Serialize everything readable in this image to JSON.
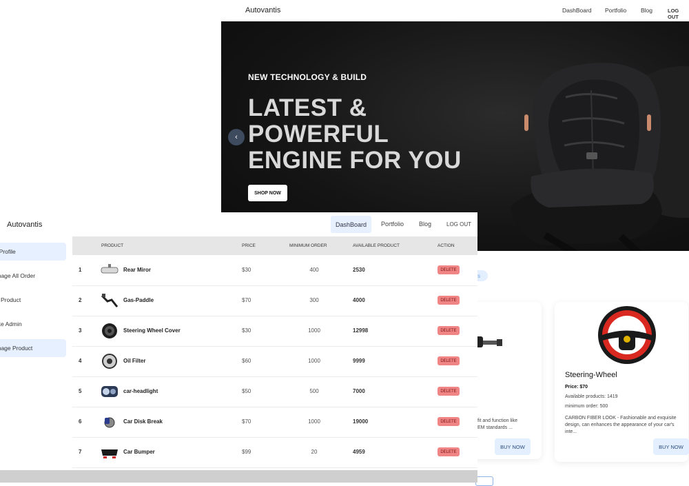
{
  "storefront": {
    "nav": {
      "brand": "Autovantis",
      "links": [
        "DashBoard",
        "Portfolio",
        "Blog",
        "LOG OUT"
      ]
    },
    "hero": {
      "kicker": "NEW TECHNOLOGY & BUILD",
      "headline": [
        "LATEST &",
        "POWERFUL",
        "ENGINE FOR YOU"
      ],
      "cta": "SHOP NOW",
      "prev_icon": "‹"
    },
    "section_badge": "ts",
    "cards": [
      {
        "title": "",
        "desc": "fit and function like\nEM standards ...",
        "buy": "BUY NOW"
      },
      {
        "title": "Steering-Wheel",
        "price": "Price: $70",
        "available": "Available products: 1419",
        "min_order": "minimum order: 500",
        "desc": "CARBON FIBER LOOK - Fashionable and exquisite design, can enhances the appearance of your car's inte...",
        "buy": "BUY NOW"
      }
    ]
  },
  "admin": {
    "nav": {
      "brand": "Autovantis",
      "dashboard": "DashBoard",
      "portfolio": "Portfolio",
      "blog": "Blog",
      "logout": "LOG OUT"
    },
    "sidebar": [
      {
        "label": "y Profile",
        "active": true
      },
      {
        "label": "anage All Order",
        "active": false
      },
      {
        "label": "ld Product",
        "active": false
      },
      {
        "label": "ake Admin",
        "active": false
      },
      {
        "label": "anage Product",
        "active": true
      }
    ],
    "table": {
      "headers": [
        "PRODUCT",
        "PRICE",
        "MINIMUM ORDER",
        "AVAILABLE PRODUCT",
        "ACTION"
      ],
      "rows": [
        {
          "n": "1",
          "name": "Rear Miror",
          "price": "$30",
          "min": "400",
          "avail": "2530",
          "action": "DELETE"
        },
        {
          "n": "2",
          "name": "Gas-Paddle",
          "price": "$70",
          "min": "300",
          "avail": "4000",
          "action": "DELETE"
        },
        {
          "n": "3",
          "name": "Steering Wheel Cover",
          "price": "$30",
          "min": "1000",
          "avail": "12998",
          "action": "DELETE"
        },
        {
          "n": "4",
          "name": "Oil Filter",
          "price": "$60",
          "min": "1000",
          "avail": "9999",
          "action": "DELETE"
        },
        {
          "n": "5",
          "name": "car-headlight",
          "price": "$50",
          "min": "500",
          "avail": "7000",
          "action": "DELETE"
        },
        {
          "n": "6",
          "name": "Car Disk Break",
          "price": "$70",
          "min": "1000",
          "avail": "19000",
          "action": "DELETE"
        },
        {
          "n": "7",
          "name": "Car Bumper",
          "price": "$99",
          "min": "20",
          "avail": "4959",
          "action": "DELETE"
        }
      ]
    }
  }
}
